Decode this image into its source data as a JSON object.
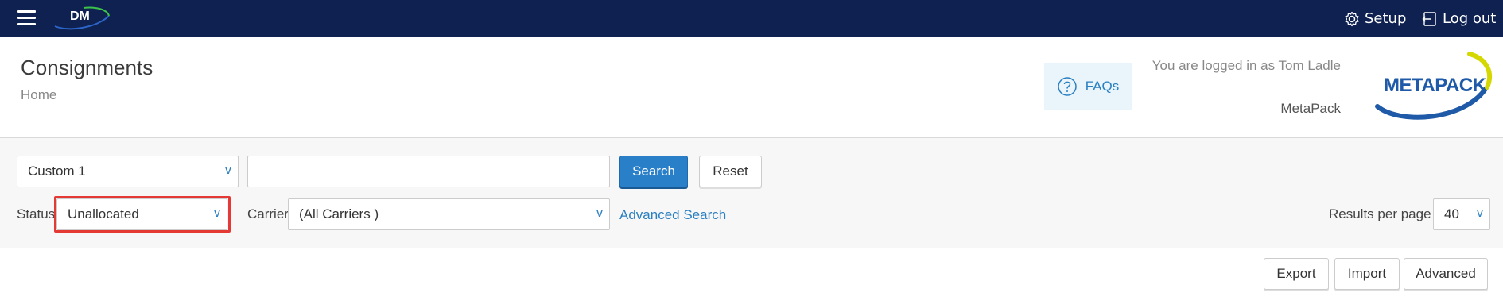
{
  "topbar": {
    "logo_text": "DM",
    "setup_label": "Setup",
    "logout_label": "Log out"
  },
  "header": {
    "title": "Consignments",
    "breadcrumb": "Home",
    "faq_label": "FAQs",
    "logged_in_text": "You are logged in as Tom Ladle",
    "company": "MetaPack",
    "brand_logo_text": "METAPACK"
  },
  "search": {
    "field_select_value": "Custom 1",
    "query_value": "",
    "search_label": "Search",
    "reset_label": "Reset",
    "status_label": "Status",
    "status_value": "Unallocated",
    "carrier_label": "Carrier",
    "carrier_value": "(All Carriers )",
    "advanced_search_label": "Advanced Search",
    "results_per_page_label": "Results per page",
    "results_per_page_value": "40",
    "chevron": "v"
  },
  "actions": {
    "export_label": "Export",
    "import_label": "Import",
    "advanced_label": "Advanced"
  },
  "colors": {
    "topbar_bg": "#0e2150",
    "accent": "#2a7fc9",
    "highlight": "#e53935"
  }
}
